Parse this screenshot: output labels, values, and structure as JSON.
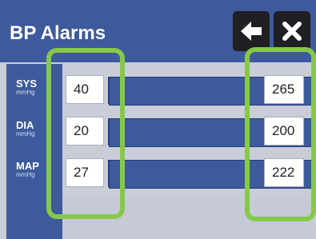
{
  "title": "BP Alarms",
  "buttons": {
    "back_icon": "arrow-left-icon",
    "close_icon": "close-icon"
  },
  "rows": [
    {
      "label": "SYS",
      "unit": "mmHg",
      "low": "40",
      "high": "265"
    },
    {
      "label": "DIA",
      "unit": "mmHg",
      "low": "20",
      "high": "200"
    },
    {
      "label": "MAP",
      "unit": "mmHg",
      "low": "27",
      "high": "222"
    }
  ],
  "colors": {
    "header": "#3d5a9c",
    "highlight": "#86c94a",
    "button": "#1f1f24"
  }
}
